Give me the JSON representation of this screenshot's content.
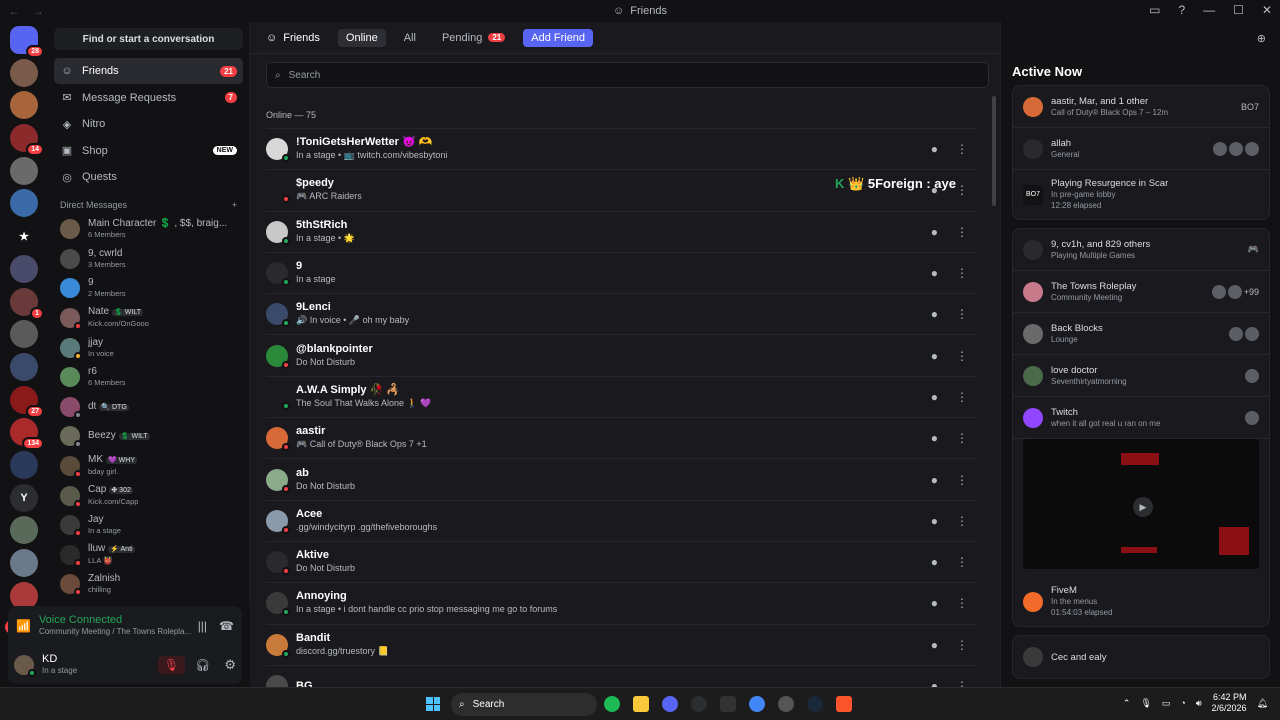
{
  "window": {
    "title": "Friends",
    "nav_back": "←",
    "nav_fwd": "→"
  },
  "guilds": [
    {
      "label": "",
      "badge": "28",
      "color": "#5865f2",
      "home": true
    },
    {
      "label": "",
      "badge": "",
      "color": "#7a5a4a"
    },
    {
      "label": "",
      "badge": "",
      "color": "#a8643a"
    },
    {
      "label": "",
      "badge": "14",
      "color": "#8a2a2a"
    },
    {
      "label": "",
      "badge": "",
      "color": "#6a6a6a"
    },
    {
      "label": "",
      "badge": "",
      "color": "#3a6aa8"
    },
    {
      "label": "★",
      "badge": "",
      "color": "#121214"
    },
    {
      "label": "",
      "badge": "",
      "color": "#4a4a6a"
    },
    {
      "label": "",
      "badge": "1",
      "color": "#6a3a3a"
    },
    {
      "label": "",
      "badge": "",
      "color": "#5a5a5a"
    },
    {
      "label": "",
      "badge": "",
      "color": "#3a4a6a"
    },
    {
      "label": "",
      "badge": "27",
      "color": "#8a1a1a"
    },
    {
      "label": "",
      "badge": "134",
      "color": "#aa2a2a"
    },
    {
      "label": "",
      "badge": "",
      "color": "#2a3a5a"
    },
    {
      "label": "Y",
      "badge": "",
      "color": "#2b2d31"
    },
    {
      "label": "",
      "badge": "",
      "color": "#5a6a5a"
    },
    {
      "label": "",
      "badge": "",
      "color": "#6a7a8a"
    },
    {
      "label": "",
      "badge": "",
      "color": "#aa3a3a"
    }
  ],
  "guild_new": "NEW",
  "dmcol": {
    "find": "Find or start a conversation",
    "nav": [
      {
        "label": "Friends",
        "icon": "friends-icon",
        "glyph": "☺",
        "pill": "21",
        "sel": true
      },
      {
        "label": "Message Requests",
        "icon": "mail-icon",
        "glyph": "✉",
        "pill": "7"
      },
      {
        "label": "Nitro",
        "icon": "nitro-icon",
        "glyph": "◈",
        "pill": ""
      },
      {
        "label": "Shop",
        "icon": "shop-icon",
        "glyph": "▣",
        "newpill": "NEW"
      },
      {
        "label": "Quests",
        "icon": "quests-icon",
        "glyph": "◎",
        "pill": ""
      }
    ],
    "dm_header": "Direct Messages",
    "dm_add": "+",
    "dms": [
      {
        "name": "Main Character 💲 , $$, braig...",
        "sub": "6 Members",
        "status": "",
        "color": "#6a5a4a"
      },
      {
        "name": "9, cwrld",
        "sub": "3 Members",
        "status": "",
        "color": "#4a4a4a"
      },
      {
        "name": "9",
        "sub": "2 Members",
        "status": "",
        "color": "#3a8ad8"
      },
      {
        "name": "Nate",
        "tag": "💲 WILT",
        "sub": "Kick.com/OnGooo",
        "status": "dnd",
        "color": "#7a5a5a"
      },
      {
        "name": "jjay",
        "sub": "In voice",
        "status": "idle",
        "color": "#5a7a7a"
      },
      {
        "name": "r6",
        "sub": "6 Members",
        "status": "",
        "color": "#5a8a5a"
      },
      {
        "name": "dt",
        "tag": "🔍 DTG",
        "sub": "",
        "status": "off",
        "color": "#8a4a6a"
      },
      {
        "name": "Beezy",
        "tag": "💲 WILT",
        "sub": "",
        "status": "off",
        "color": "#6a6a5a"
      },
      {
        "name": "MK",
        "tag": "💜 WHY",
        "sub": "bday girl.",
        "status": "dnd",
        "color": "#5a4a3a"
      },
      {
        "name": "Cap",
        "tag": "✤ 302",
        "sub": "Kick.com/Capp",
        "status": "dnd",
        "color": "#5a5a4a"
      },
      {
        "name": "Jay",
        "sub": "In a stage",
        "status": "dnd",
        "color": "#3a3a3a"
      },
      {
        "name": "lluw",
        "tag": "⚡ Anti",
        "sub": "LLA 👹",
        "status": "dnd",
        "color": "#2a2a2a"
      },
      {
        "name": "Zalnish",
        "sub": "chilling",
        "status": "dnd",
        "color": "#6a4a3a"
      }
    ]
  },
  "voice": {
    "title": "Voice Connected",
    "sub": "Community Meeting / The Towns Roleplа..."
  },
  "user": {
    "name": "KD",
    "sub": "In a stage"
  },
  "main": {
    "tabs": {
      "title": "Friends",
      "online": "Online",
      "all": "All",
      "pending": "Pending",
      "pending_count": "21",
      "add": "Add Friend"
    },
    "search_placeholder": "Search",
    "online_count": "Online — 75",
    "overlay": "5Foreign : aye",
    "friends": [
      {
        "name": "!ToniGetsHerWetter 😈 🫶",
        "sub": "In a stage • 📺 twitch.com/vibesbytoni",
        "status": "",
        "color": "#d8d8d8"
      },
      {
        "name": "$peedy",
        "sub": "🎮 ARC Raiders",
        "status": "dnd",
        "color": "#1a1a1e"
      },
      {
        "name": "5thStRich",
        "sub": "In a stage • 🌟",
        "status": "",
        "color": "#c8c8c8"
      },
      {
        "name": "9",
        "sub": "In a stage",
        "status": "",
        "color": "#2a2a2e"
      },
      {
        "name": "9Lenci",
        "sub": "🔊 In voice • 🎤 oh my baby",
        "status": "",
        "color": "#3a4a6a"
      },
      {
        "name": "@blankpointer",
        "sub": "Do Not Disturb",
        "status": "dnd",
        "color": "#2a8a3a"
      },
      {
        "name": "A.W.A Simply 🥀 🦂",
        "sub": "The Soul That Walks Alone 🚶 💜",
        "status": "",
        "color": "#1a1a1e"
      },
      {
        "name": "aastir",
        "sub": "🎮 Call of Duty® Black Ops 7 +1",
        "status": "dnd",
        "color": "#d86a3a"
      },
      {
        "name": "ab",
        "sub": "Do Not Disturb",
        "status": "dnd",
        "color": "#8aaa8a"
      },
      {
        "name": "Acee",
        "sub": ".gg/windycityrp .gg/thefiveboroughs",
        "status": "dnd",
        "color": "#8a9aaa"
      },
      {
        "name": "Aktive",
        "sub": "Do Not Disturb",
        "status": "dnd",
        "color": "#2a2a2e"
      },
      {
        "name": "Annoying",
        "sub": "In a stage • i dont handle cc prio stop messaging me go to forums",
        "status": "",
        "color": "#3a3a3a"
      },
      {
        "name": "Bandit",
        "sub": "discord.gg/truestory 📒",
        "status": "",
        "color": "#c87a3a"
      },
      {
        "name": "BG",
        "sub": "",
        "status": "",
        "color": "#4a4a4a"
      }
    ]
  },
  "active": {
    "title": "Active Now",
    "cards": [
      {
        "rows": [
          {
            "name": "aastir, Mar, and 1 other",
            "sub": "Call of Duty® Black Ops 7 – 12m",
            "end": "BO7",
            "color": "#d86a3a"
          },
          {
            "name": "allah",
            "sub": "General",
            "end": "",
            "color": "#2a2a2e",
            "minis": 3
          },
          {
            "name": "Playing Resurgence in Scar",
            "sub": "In pre-game lobby",
            "sub2": "12:28 elapsed",
            "end": "",
            "color": "#121214",
            "logo": "BO7"
          }
        ]
      },
      {
        "rows": [
          {
            "name": "9, cv1h, and 829 others",
            "sub": "Playing Multiple Games",
            "end": "🎮",
            "color": "#2a2a2e"
          },
          {
            "name": "The Towns Roleplay",
            "sub": "Community Meeting",
            "end": "+99",
            "color": "#c87a8a",
            "minis": 2
          },
          {
            "name": "Back Blocks",
            "sub": "Lounge",
            "end": "",
            "color": "#6a6a6a",
            "minis": 2
          },
          {
            "name": "love doctor",
            "sub": "Seventhirtyatmorning",
            "end": "",
            "color": "#4a6a4a",
            "minis": 1
          },
          {
            "name": "Twitch",
            "sub": "when it all got real u ran on me",
            "end": "",
            "color": "#9146ff",
            "minis": 1,
            "stream": true
          },
          {
            "name": "FiveM",
            "sub": "In the menus",
            "sub2": "01:54:03 elapsed",
            "end": "",
            "color": "#f26b2a"
          }
        ]
      },
      {
        "rows": [
          {
            "name": "Cec and ealy",
            "sub": "",
            "end": "",
            "color": "#3a3a3a"
          }
        ]
      }
    ]
  },
  "taskbar": {
    "search": "Search",
    "time": "6:42 PM",
    "date": "2/6/2026"
  }
}
